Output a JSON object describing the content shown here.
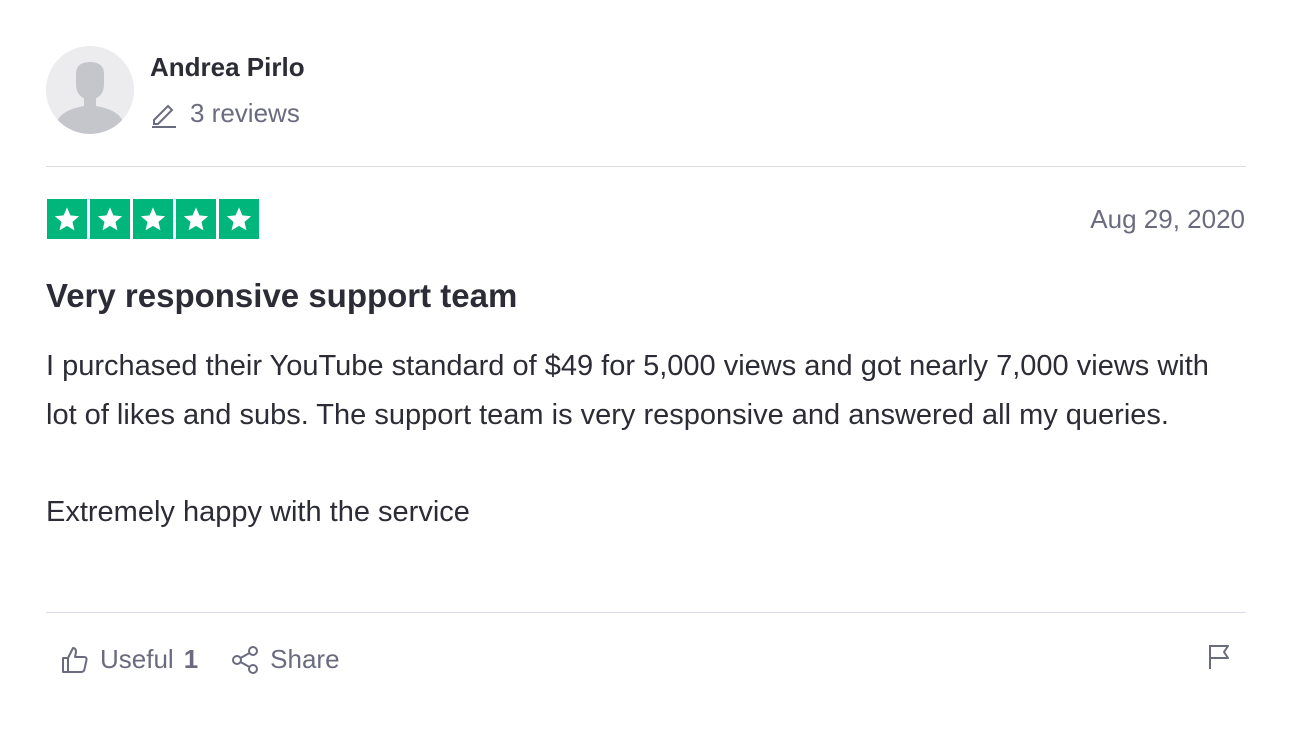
{
  "author": {
    "name": "Andrea Pirlo",
    "reviews_count": "3 reviews"
  },
  "review": {
    "rating": 5,
    "max_rating": 5,
    "star_color": "#00b67a",
    "date": "Aug 29, 2020",
    "title": "Very responsive support team",
    "paragraphs": [
      "I purchased their YouTube standard of $49 for 5,000 views and got nearly 7,000 views with lot of likes and subs. The support team is very responsive and answered all my queries.",
      "Extremely happy with the service"
    ]
  },
  "actions": {
    "useful_label": "Useful",
    "useful_count": "1",
    "share_label": "Share",
    "useful_icon": "thumbs-up-icon",
    "share_icon": "share-icon",
    "flag_icon": "flag-icon"
  }
}
